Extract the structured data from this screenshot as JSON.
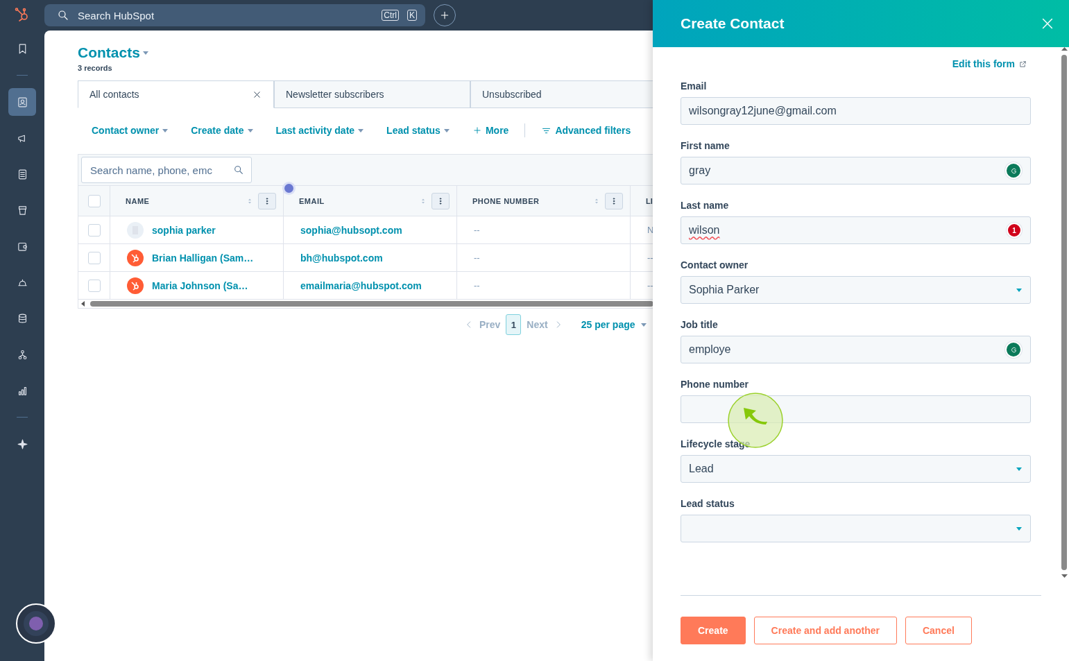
{
  "top_bar": {
    "search": {
      "placeholder": "Search HubSpot",
      "shortcut": [
        "Ctrl",
        "K"
      ]
    }
  },
  "sidebar": {
    "groups": [
      {
        "items": [
          {
            "kind": "bookmark",
            "selected": false
          }
        ]
      },
      {
        "items": [
          {
            "kind": "contacts",
            "selected": true
          },
          {
            "kind": "megaphone",
            "selected": false
          },
          {
            "kind": "document",
            "selected": false
          },
          {
            "kind": "store",
            "selected": false
          },
          {
            "kind": "wallet",
            "selected": false
          },
          {
            "kind": "bell",
            "selected": false
          },
          {
            "kind": "database",
            "selected": false
          },
          {
            "kind": "network",
            "selected": false
          },
          {
            "kind": "chart",
            "selected": false
          }
        ]
      },
      {
        "items": [
          {
            "kind": "sparkle",
            "selected": false
          }
        ]
      }
    ]
  },
  "page": {
    "title": "Contacts",
    "subtitle": "3 records"
  },
  "view_tabs": [
    {
      "label": "All contacts",
      "selected": true
    },
    {
      "label": "Newsletter subscribers",
      "selected": false
    },
    {
      "label": "Unsubscribed",
      "selected": false
    }
  ],
  "filters": [
    {
      "label": "Contact owner",
      "kind": "dropdown"
    },
    {
      "label": "Create date",
      "kind": "dropdown"
    },
    {
      "label": "Last activity date",
      "kind": "dropdown"
    },
    {
      "label": "Lead status",
      "kind": "dropdown"
    },
    {
      "label": "More",
      "kind": "more"
    },
    {
      "label": "Advanced filters",
      "kind": "advanced"
    }
  ],
  "table": {
    "search": {
      "placeholder": "Search name, phone, emc"
    },
    "select_all_checked": false,
    "columns": [
      {
        "label": "NAME"
      },
      {
        "label": "EMAIL"
      },
      {
        "label": "PHONE NUMBER"
      },
      {
        "label": "LI"
      }
    ],
    "rows": [
      {
        "checked": false,
        "kind": "company",
        "name": "sophia parker",
        "email": "sophia@hubsopt.com",
        "phone": "--",
        "column_4": "N"
      },
      {
        "checked": false,
        "kind": "sprocket",
        "name": "Brian Halligan (Sam…",
        "email": "bh@hubspot.com",
        "phone": "--",
        "column_4": "--"
      },
      {
        "checked": false,
        "kind": "sprocket",
        "name": "Maria Johnson (Sa…",
        "email": "emailmaria@hubspot.com",
        "phone": "--",
        "column_4": "--"
      }
    ]
  },
  "pagination": {
    "prev": {
      "label": "Prev",
      "disabled": true
    },
    "pages": [
      {
        "label": "1",
        "selected": true
      }
    ],
    "next": {
      "label": "Next",
      "disabled": true
    },
    "per_page": "25 per page"
  },
  "panel": {
    "title": "Create Contact",
    "edit_link": "Edit this form",
    "fields": [
      {
        "label": "Email",
        "kind": "text",
        "value": "wilsongray12june@gmail.com"
      },
      {
        "label": "First name",
        "kind": "text",
        "value": "gray",
        "assist": {
          "kind": "ok"
        }
      },
      {
        "label": "Last name",
        "kind": "text",
        "value": "wilson",
        "misspelled": true,
        "assist": {
          "kind": "issues",
          "count": "1"
        }
      },
      {
        "label": "Contact owner",
        "kind": "select",
        "value": "Sophia Parker"
      },
      {
        "label": "Job title",
        "kind": "text",
        "value": "employe",
        "assist": {
          "kind": "ok"
        }
      },
      {
        "label": "Phone number",
        "kind": "text"
      },
      {
        "label": "Lifecycle stage",
        "kind": "select",
        "value": "Lead"
      },
      {
        "label": "Lead status",
        "kind": "select"
      }
    ],
    "buttons": [
      {
        "label": "Create",
        "kind": "primary"
      },
      {
        "label": "Create and add another",
        "kind": "secondary"
      },
      {
        "label": "Cancel",
        "kind": "secondary"
      }
    ]
  }
}
